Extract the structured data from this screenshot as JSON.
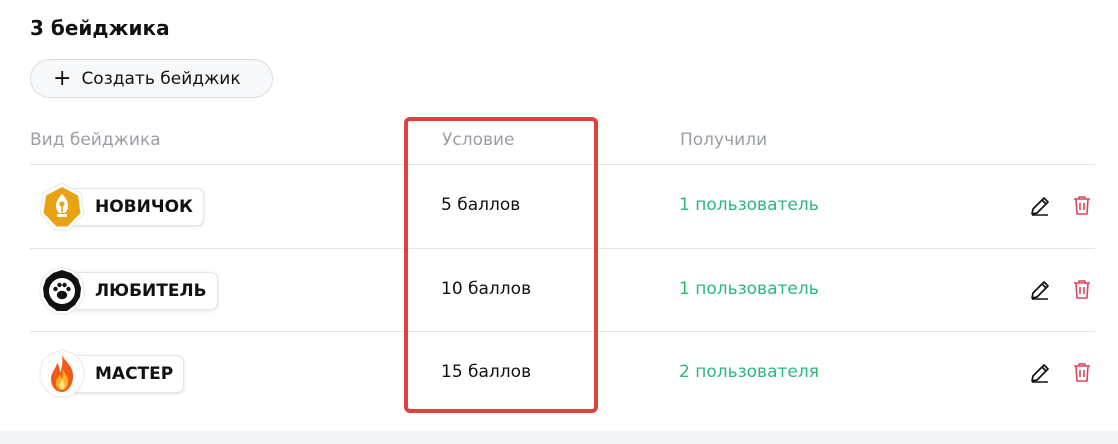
{
  "header": {
    "title": "3 бейджика",
    "create_button": {
      "icon": "plus-icon",
      "label": "Создать бейджик"
    }
  },
  "columns": {
    "badge": "Вид бейджика",
    "condition": "Условие",
    "received": "Получили"
  },
  "rows": [
    {
      "badge_name": "НОВИЧОК",
      "badge_icon": "quill-pen-icon",
      "condition": "5 баллов",
      "received": "1 пользователь"
    },
    {
      "badge_name": "ЛЮБИТЕЛЬ",
      "badge_icon": "paw-icon",
      "condition": "10 баллов",
      "received": "1 пользователь"
    },
    {
      "badge_name": "МАСТЕР",
      "badge_icon": "flame-icon",
      "condition": "15 баллов",
      "received": "2 пользователя"
    }
  ],
  "actions": {
    "edit_icon": "pencil-icon",
    "delete_icon": "trash-icon"
  },
  "colors": {
    "accent_green": "#2db87a",
    "delete_red": "#e0435d",
    "highlight_red": "#e2403a",
    "newbie_orange": "#e8a213",
    "amateur_black": "#111111"
  }
}
